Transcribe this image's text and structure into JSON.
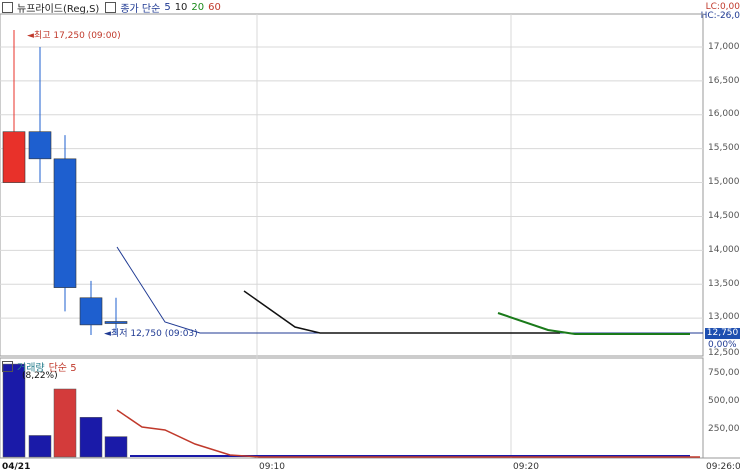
{
  "legend": {
    "stock": "뉴프라이드(Reg,S)",
    "ma_label": "종가 단순",
    "ma_periods": [
      "5",
      "10",
      "20",
      "60"
    ]
  },
  "header_right": {
    "lc": "LC:0,00",
    "hc": "HC:-26,0"
  },
  "price_annotations": {
    "high": "최고 17,250 (09:00)",
    "low": "최저 12,750 (09:03)"
  },
  "price_axis": [
    "17,000",
    "16,500",
    "16,000",
    "15,500",
    "15,000",
    "14,500",
    "14,000",
    "13,500",
    "13,000",
    "12,500"
  ],
  "current_price_tag": "12,750",
  "current_pct": "0,00%",
  "volume_legend": {
    "label": "거래량",
    "ma": "단순 5",
    "pct": "(8,22%)"
  },
  "volume_axis": [
    "750,000",
    "500,000",
    "250,000"
  ],
  "time_axis": {
    "date": "04/21",
    "t1": "09:10",
    "t2": "09:20",
    "t3": "09:26:0"
  },
  "colors": {
    "up": "#e8312a",
    "down": "#1e5fcf",
    "ma5": "#1f3a93",
    "ma10": "#111111",
    "ma20": "#1a7a1a",
    "ma60": "#c0392b",
    "grid": "#d8d8d8"
  },
  "chart_data": {
    "type": "candlestick",
    "x": [
      "09:00",
      "09:01",
      "09:02",
      "09:03",
      "09:04"
    ],
    "open": [
      15750,
      15750,
      15350,
      13300,
      12950
    ],
    "high": [
      17250,
      17000,
      15700,
      13550,
      13300
    ],
    "low": [
      15000,
      15000,
      13100,
      12750,
      12750
    ],
    "close": [
      15000,
      15350,
      13450,
      12900,
      12950
    ],
    "volume": [
      820000,
      190000,
      600000,
      350000,
      180000
    ],
    "volume_ma5": [
      420000,
      270000,
      250000,
      40000
    ]
  }
}
